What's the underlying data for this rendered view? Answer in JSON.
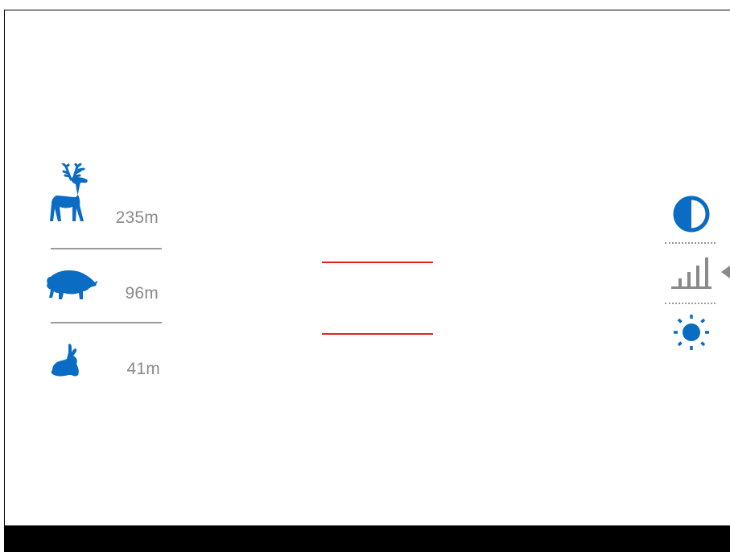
{
  "rangefinder": {
    "targets": [
      {
        "animal": "deer-icon",
        "distance": "235m"
      },
      {
        "animal": "boar-icon",
        "distance": "96m"
      },
      {
        "animal": "hare-icon",
        "distance": "41m"
      }
    ]
  },
  "quick_menu": {
    "items": [
      "contrast-icon",
      "signal-bars-icon",
      "brightness-icon"
    ],
    "selected": "signal-bars-icon"
  },
  "colors": {
    "accent": "#0a6cc2",
    "marker": "#e8201e",
    "muted": "#8a8a8a"
  }
}
